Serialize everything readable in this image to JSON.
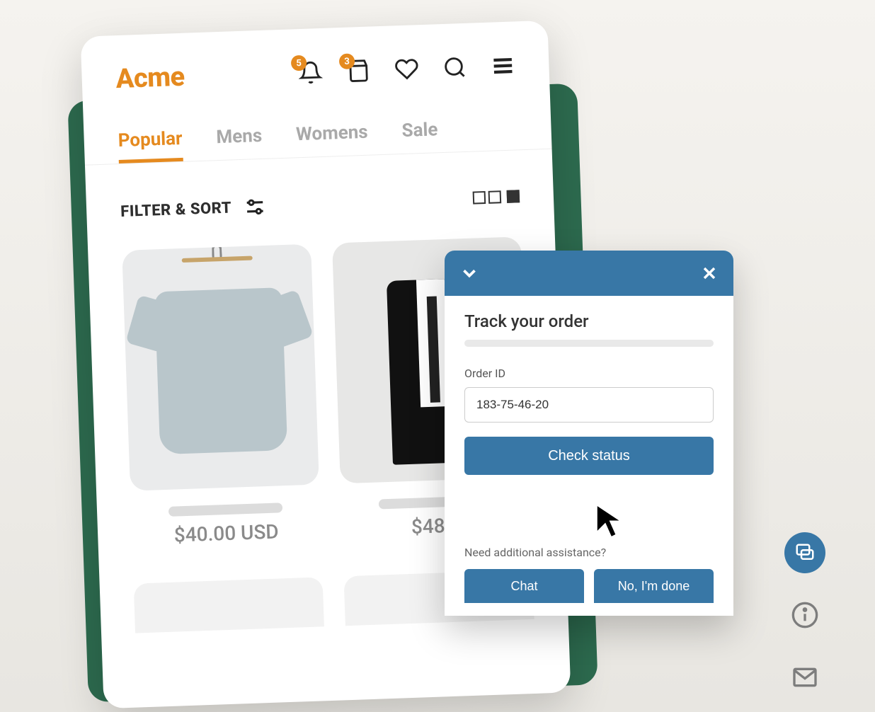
{
  "brand": "Acme",
  "colors": {
    "accent": "#e58a1f",
    "primary": "#3877a6",
    "backdrop": "#2d6b4f"
  },
  "header": {
    "notification_badge": "5",
    "bag_badge": "3"
  },
  "tabs": [
    {
      "label": "Popular",
      "active": true
    },
    {
      "label": "Mens",
      "active": false
    },
    {
      "label": "Womens",
      "active": false
    },
    {
      "label": "Sale",
      "active": false
    }
  ],
  "filter_label": "FILTER  & SORT",
  "products": [
    {
      "price": "$40.00 USD"
    },
    {
      "price": "$48.0"
    }
  ],
  "chat": {
    "title": "Track your order",
    "field_label": "Order ID",
    "order_value": "183-75-46-20",
    "submit_label": "Check status",
    "assist_text": "Need additional assistance?",
    "chat_btn": "Chat",
    "done_btn": "No, I'm done"
  }
}
